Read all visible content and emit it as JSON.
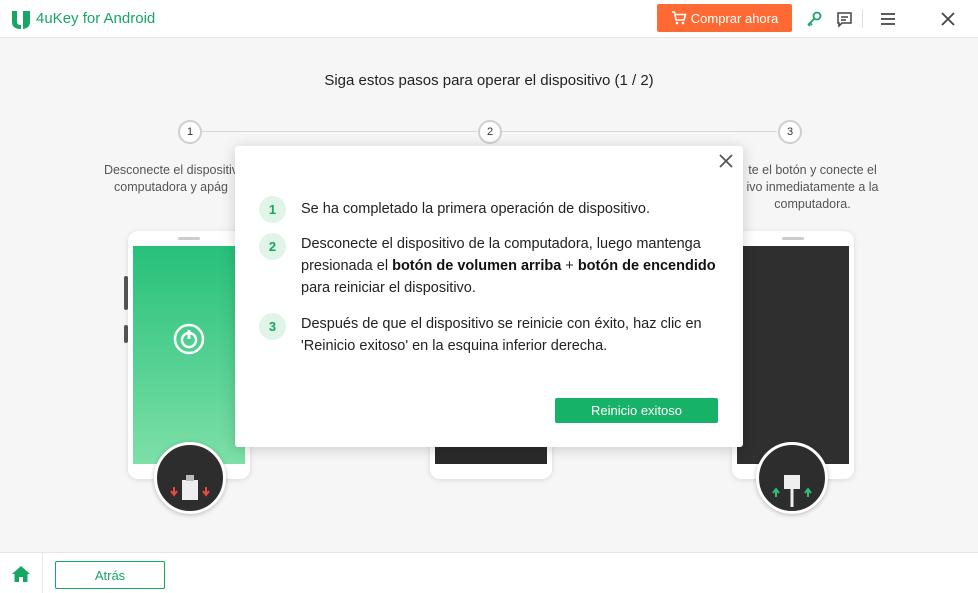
{
  "app": {
    "name": "4uKey for Android",
    "buy_label": "Comprar ahora"
  },
  "colors": {
    "brand": "#17a663",
    "buy": "#ff6a34",
    "success_button": "#16b268"
  },
  "icons": [
    "app-logo-icon",
    "cart-icon",
    "key-icon",
    "feedback-icon",
    "menu-icon",
    "close-icon",
    "home-icon"
  ],
  "main": {
    "heading": "Siga estos pasos para operar el dispositivo (1 / 2)",
    "steps": [
      {
        "number": "1",
        "text_line1": "Desconecte el dispositiv",
        "text_line2": "computadora y apág"
      },
      {
        "number": "2"
      },
      {
        "number": "3",
        "text_line1": "te el botón y conecte el",
        "text_line2": "ivo inmediatamente a la",
        "text_line3": "computadora."
      }
    ]
  },
  "dialog": {
    "items": [
      {
        "number": "1",
        "text": "Se ha completado la primera operación de dispositivo."
      },
      {
        "number": "2",
        "text_pre": "Desconecte el dispositivo de la computadora, luego mantenga presionada el ",
        "bold1": "botón de volumen arriba",
        "text_mid": " + ",
        "bold2": "botón de encendido",
        "text_post": " para reiniciar el dispositivo."
      },
      {
        "number": "3",
        "text": "Después de que el dispositivo se reinicie con éxito, haz clic en 'Reinicio exitoso' en la esquina inferior derecha."
      }
    ],
    "button_label": "Reinicio exitoso"
  },
  "footer": {
    "back_label": "Atrás"
  }
}
